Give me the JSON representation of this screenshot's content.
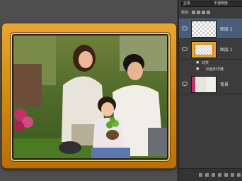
{
  "panel": {
    "blend_mode": "正常",
    "opacity_label": "不透明度",
    "lock_label": "锁定:",
    "layers": [
      {
        "name": "图层 2",
        "selected": true
      },
      {
        "name": "图层 1",
        "selected": false
      },
      {
        "name": "背景",
        "selected": false
      }
    ],
    "effects_label": "效果",
    "effect_item": "斜面和浮雕"
  },
  "colors": {
    "frame": "#d08a12",
    "panel_bg": "#3c3c3c",
    "selected_row": "#4a5d78"
  }
}
